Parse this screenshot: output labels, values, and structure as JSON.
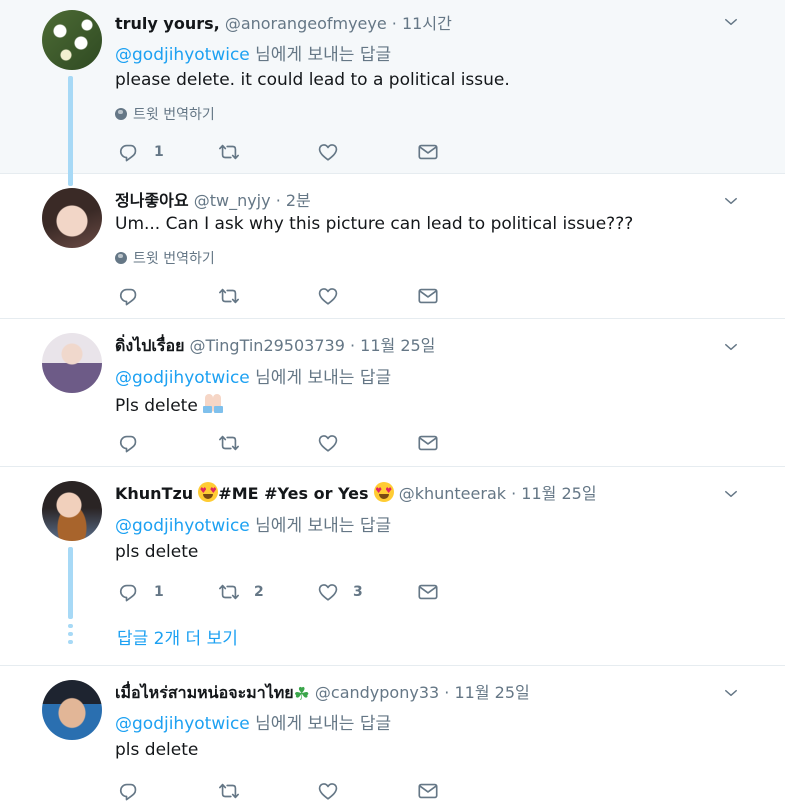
{
  "tweets": [
    {
      "name": "truly yours,",
      "handle": "@anorangeofmyeye",
      "dot": "·",
      "time": "11시간",
      "reply_mention": "@godjihyotwice",
      "reply_suffix": " 님에게 보내는 답글",
      "text": "please delete. it could lead to a political issue.",
      "translate": "트윗 번역하기",
      "reply_count": "1",
      "retweet_count": "",
      "like_count": ""
    },
    {
      "name": "정나좋아요",
      "handle": "@tw_nyjy",
      "dot": "·",
      "time": "2분",
      "text": "Um... Can I ask why this picture can lead to political issue???",
      "translate": "트윗 번역하기"
    },
    {
      "name": "ดิ่งไปเรื่อย",
      "handle": "@TingTin29503739",
      "dot": "·",
      "time": "11월 25일",
      "reply_mention": "@godjihyotwice",
      "reply_suffix": " 님에게 보내는 답글",
      "text": "Pls delete",
      "hands_icon": "folded-hands-emoji"
    },
    {
      "name_part1": "KhunTzu",
      "name_part2": "#ME #Yes or Yes",
      "handle": "@khunteerak",
      "dot": "·",
      "time": "11월 25일",
      "reply_mention": "@godjihyotwice",
      "reply_suffix": " 님에게 보내는 답글",
      "text": "pls delete",
      "reply_count": "1",
      "retweet_count": "2",
      "like_count": "3",
      "show_more": "답글 2개 더 보기",
      "emoji_icon": "heart-eyes-emoji"
    },
    {
      "name": "เมื่อไหร่สามหน่อจะมาไทย",
      "clover": "☘",
      "handle": "@candypony33",
      "dot": "·",
      "time": "11월 25일",
      "reply_mention": "@godjihyotwice",
      "reply_suffix": " 님에게 보내는 답글",
      "text": "pls delete"
    }
  ],
  "colors": {
    "accent": "#1da1f2",
    "muted": "#657786",
    "thread_line": "#a7d9f6",
    "highlight_bg": "#f5f8fa",
    "border": "#e6ecf0"
  }
}
